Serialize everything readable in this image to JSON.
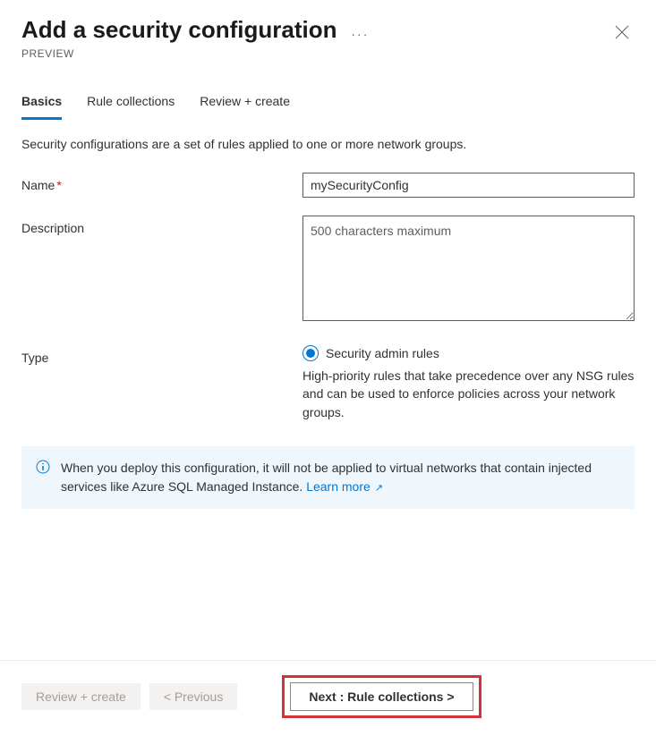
{
  "header": {
    "title": "Add a security configuration",
    "subtitle": "PREVIEW"
  },
  "tabs": [
    {
      "label": "Basics",
      "active": true
    },
    {
      "label": "Rule collections",
      "active": false
    },
    {
      "label": "Review + create",
      "active": false
    }
  ],
  "intro": "Security configurations are a set of rules applied to one or more network groups.",
  "form": {
    "name": {
      "label": "Name",
      "value": "mySecurityConfig",
      "required": true
    },
    "description": {
      "label": "Description",
      "placeholder": "500 characters maximum"
    },
    "type": {
      "label": "Type",
      "option_label": "Security admin rules",
      "help": "High-priority rules that take precedence over any NSG rules and can be used to enforce policies across your network groups."
    }
  },
  "info": {
    "text": "When you deploy this configuration, it will not be applied to virtual networks that contain injected services like Azure SQL Managed Instance.  ",
    "link_label": "Learn more"
  },
  "footer": {
    "review": "Review + create",
    "previous": "< Previous",
    "next": "Next : Rule collections >"
  }
}
